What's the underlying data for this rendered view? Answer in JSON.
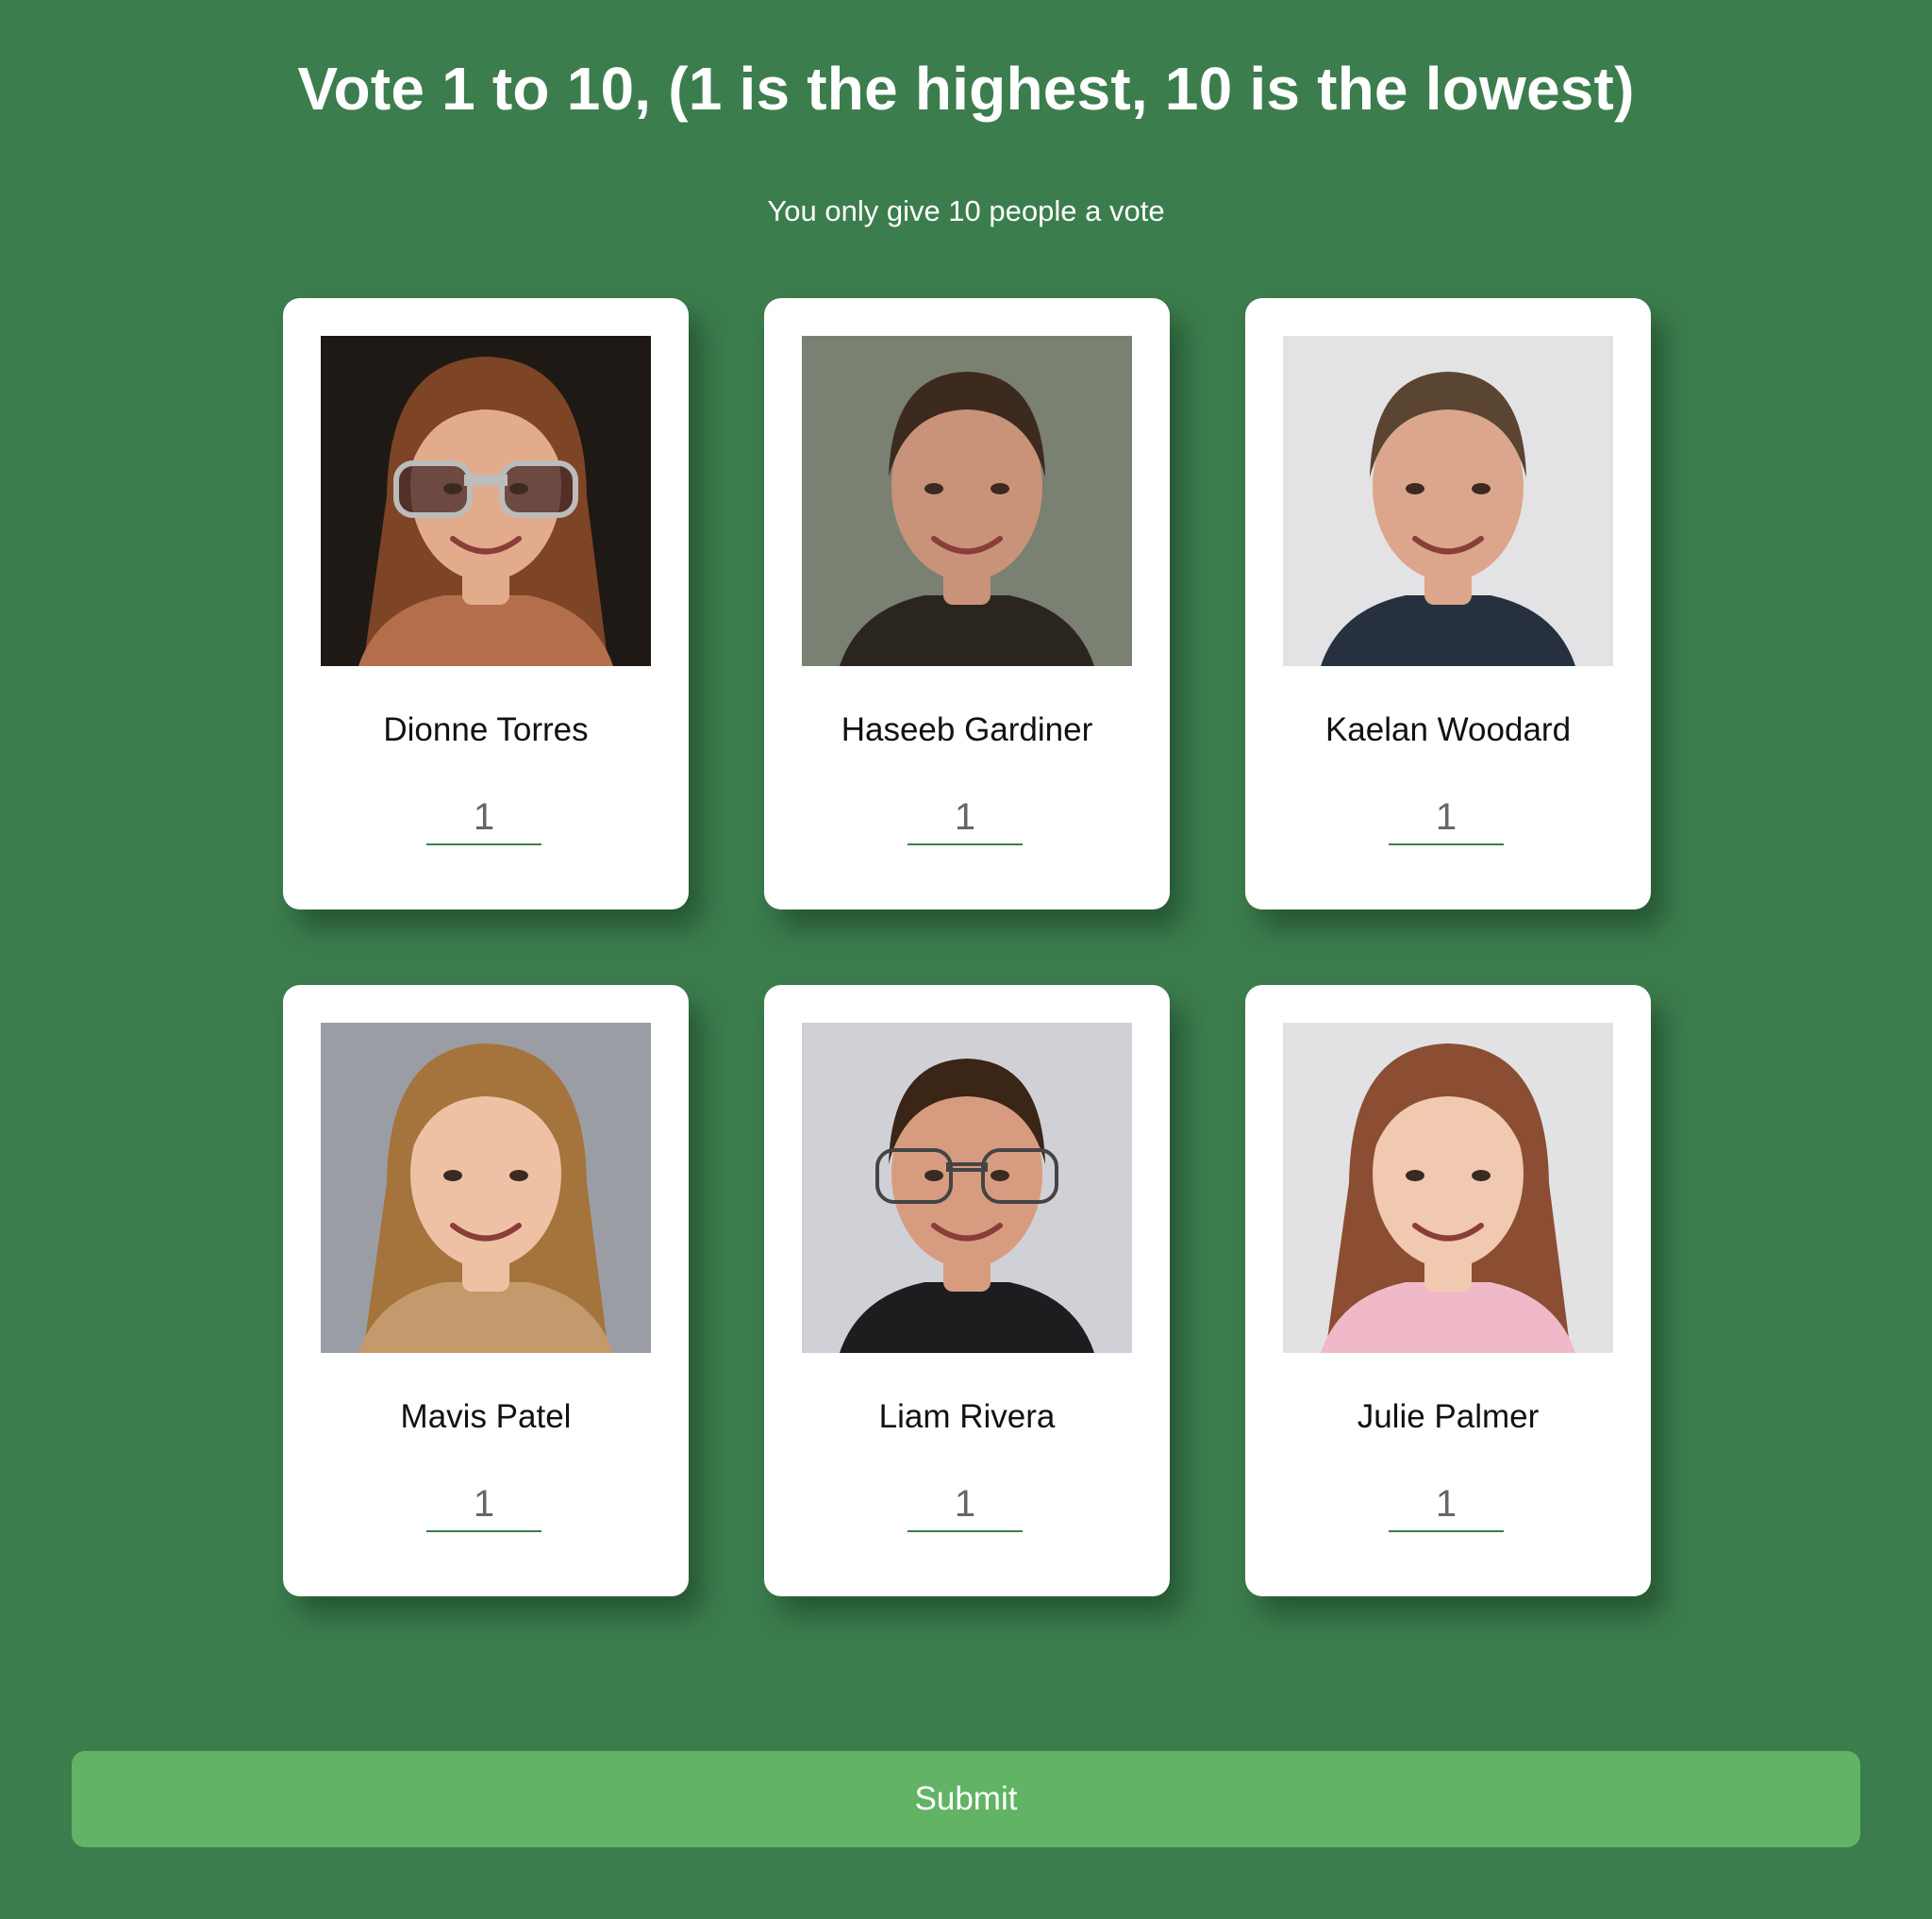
{
  "header": {
    "title": "Vote 1 to 10, (1 is the highest, 10 is the lowest)",
    "subtitle": "You only give 10 people a vote"
  },
  "candidates": [
    {
      "name": "Dionne Torres",
      "vote": "1",
      "photo": {
        "bg": "#1e1915",
        "skin": "#e2ab8b",
        "hair": "#7e4426",
        "shirt": "#b56e4c",
        "glasses": "sunglasses",
        "hair_style": "long"
      }
    },
    {
      "name": "Haseeb Gardiner",
      "vote": "1",
      "photo": {
        "bg": "#7a8072",
        "skin": "#c9937a",
        "hair": "#3d2a1f",
        "shirt": "#2b2520",
        "glasses": "none",
        "hair_style": "short"
      }
    },
    {
      "name": "Kaelan Woodard",
      "vote": "1",
      "photo": {
        "bg": "#e3e3e5",
        "skin": "#dba68b",
        "hair": "#5a4432",
        "shirt": "#27303e",
        "glasses": "none",
        "hair_style": "short"
      }
    },
    {
      "name": "Mavis Patel",
      "vote": "1",
      "photo": {
        "bg": "#9a9ea4",
        "skin": "#efc1a4",
        "hair": "#a5743d",
        "shirt": "#c49a6c",
        "glasses": "none",
        "hair_style": "long"
      }
    },
    {
      "name": "Liam Rivera",
      "vote": "1",
      "photo": {
        "bg": "#d0d1d6",
        "skin": "#d79c80",
        "hair": "#3a2516",
        "shirt": "#1d1d1f",
        "glasses": "glasses",
        "hair_style": "short"
      }
    },
    {
      "name": "Julie Palmer",
      "vote": "1",
      "photo": {
        "bg": "#e2e2e4",
        "skin": "#f1c9b0",
        "hair": "#8b4e33",
        "shirt": "#f0b9c8",
        "glasses": "none",
        "hair_style": "long"
      }
    }
  ],
  "submit": {
    "label": "Submit"
  }
}
